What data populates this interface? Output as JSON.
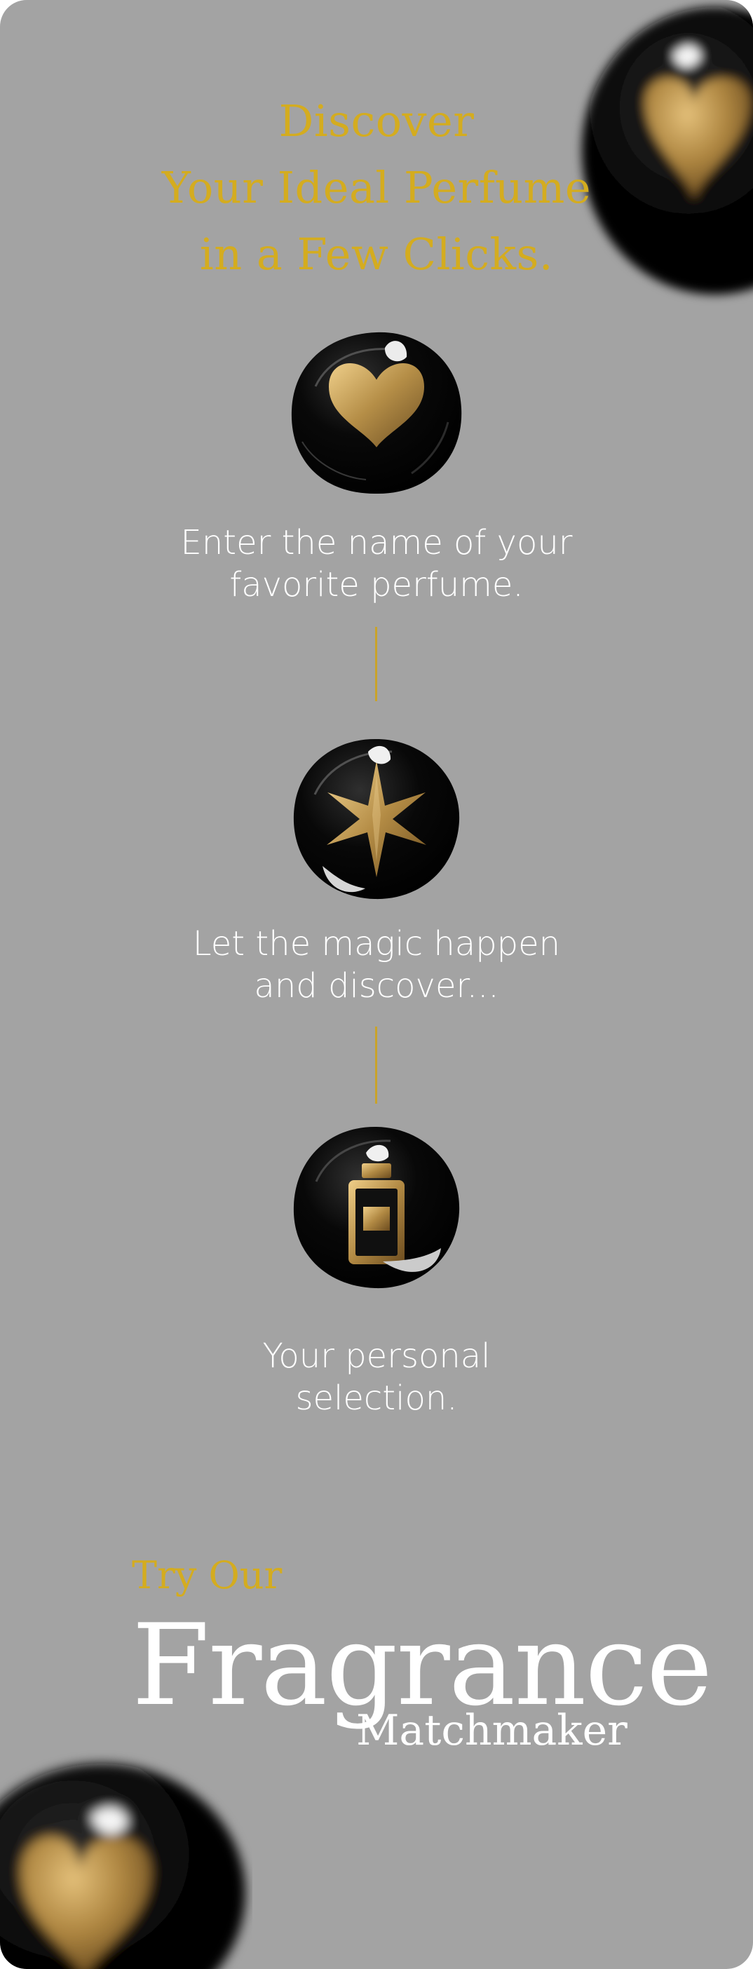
{
  "header": {
    "line1": "Discover",
    "line2": "Your Ideal Perfume",
    "line3": "in a Few Clicks."
  },
  "steps": [
    {
      "icon": "heart-icon",
      "line1": "Enter the name of your",
      "line2": "favorite perfume."
    },
    {
      "icon": "star-icon",
      "line1": "Let the magic happen",
      "line2": "and discover..."
    },
    {
      "icon": "perfume-bottle-icon",
      "line1": "Your personal",
      "line2": "selection."
    }
  ],
  "cta": {
    "try_label": "Try Our",
    "title": "Fragrance",
    "subtitle": "Matchmaker"
  },
  "colors": {
    "background": "#a3a3a3",
    "gold": "#d4ac1f",
    "text": "#ffffff",
    "badge": "#090909"
  }
}
